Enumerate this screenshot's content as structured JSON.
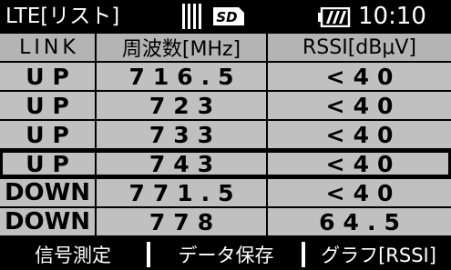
{
  "status": {
    "title": "LTE[リスト]",
    "sd_label": "SD",
    "clock": "10:10",
    "icons": [
      "signal-bars-icon",
      "sd-card-icon",
      "battery-icon"
    ]
  },
  "table": {
    "headers": [
      "LINK",
      "周波数[MHz]",
      "RSSI[dBμV]"
    ],
    "rows": [
      {
        "link": "UP",
        "freq": "716.5",
        "rssi": "<40"
      },
      {
        "link": "UP",
        "freq": "723",
        "rssi": "<40"
      },
      {
        "link": "UP",
        "freq": "733",
        "rssi": "<40"
      },
      {
        "link": "UP",
        "freq": "743",
        "rssi": "<40"
      },
      {
        "link": "DOWN",
        "freq": "771.5",
        "rssi": "<40"
      },
      {
        "link": "DOWN",
        "freq": "778",
        "rssi": "64.5"
      }
    ],
    "selected_row": 4
  },
  "softkeys": [
    "信号測定",
    "データ保存",
    "グラフ[RSSI]"
  ],
  "colors": {
    "background": "#000000",
    "row": "#c0c0c0",
    "header": "#b4b4b4",
    "text_light": "#ffffff"
  }
}
